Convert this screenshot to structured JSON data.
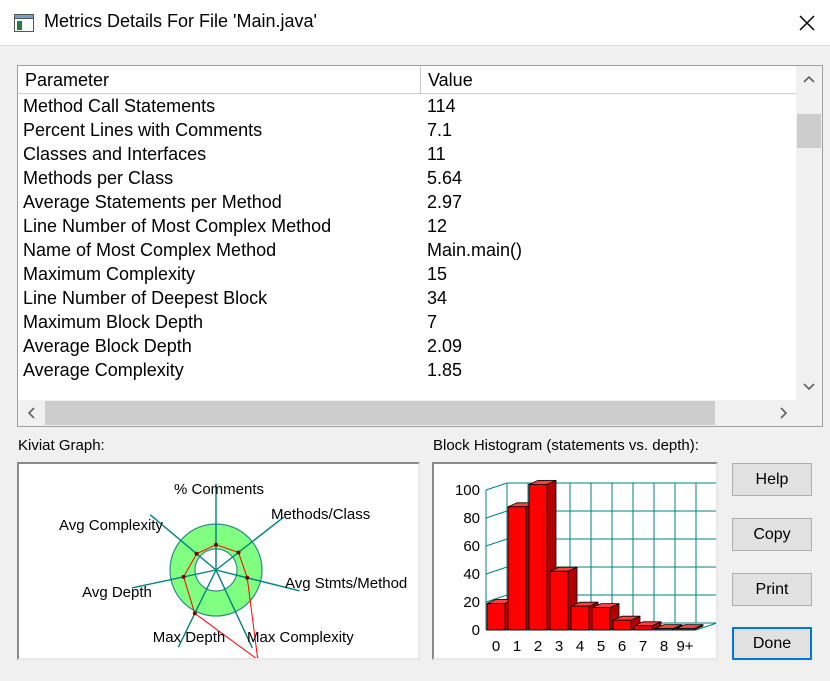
{
  "window": {
    "title": "Metrics Details For File 'Main.java'",
    "accent_color": "#0078d7"
  },
  "metrics_table": {
    "columns": [
      "Parameter",
      "Value"
    ],
    "rows": [
      [
        "Method Call Statements",
        "114"
      ],
      [
        "Percent Lines with Comments",
        "7.1"
      ],
      [
        "Classes and Interfaces",
        "11"
      ],
      [
        "Methods per Class",
        "5.64"
      ],
      [
        "Average Statements per Method",
        "2.97"
      ],
      [
        "Line Number of Most Complex Method",
        "12"
      ],
      [
        "Name of Most Complex Method",
        "Main.main()"
      ],
      [
        "Maximum Complexity",
        "15"
      ],
      [
        "Line Number of Deepest Block",
        "34"
      ],
      [
        "Maximum Block Depth",
        "7"
      ],
      [
        "Average Block Depth",
        "2.09"
      ],
      [
        "Average Complexity",
        "1.85"
      ]
    ]
  },
  "kiviat": {
    "label": "Kiviat Graph:",
    "axes": [
      "% Comments",
      "Methods/Class",
      "Avg Stmts/Method",
      "Max Complexity",
      "Max Depth",
      "Avg Depth",
      "Avg Complexity"
    ],
    "ring_color": "#80ff80",
    "polygon_color": "#ff0000"
  },
  "histogram": {
    "label": "Block Histogram (statements vs. depth):",
    "bar_color": "#ff0000",
    "grid_color": "#008080"
  },
  "chart_data": {
    "type": "bar",
    "categories": [
      "0",
      "1",
      "2",
      "3",
      "4",
      "5",
      "6",
      "7",
      "8",
      "9+"
    ],
    "values": [
      19,
      88,
      104,
      42,
      17,
      16,
      7,
      3,
      1,
      1
    ],
    "xlabel": "",
    "ylabel": "",
    "ylim": [
      0,
      100
    ],
    "yticks": [
      0,
      20,
      40,
      60,
      80,
      100
    ],
    "grid": true
  },
  "buttons": {
    "help": "Help",
    "copy": "Copy",
    "print": "Print",
    "done": "Done"
  }
}
